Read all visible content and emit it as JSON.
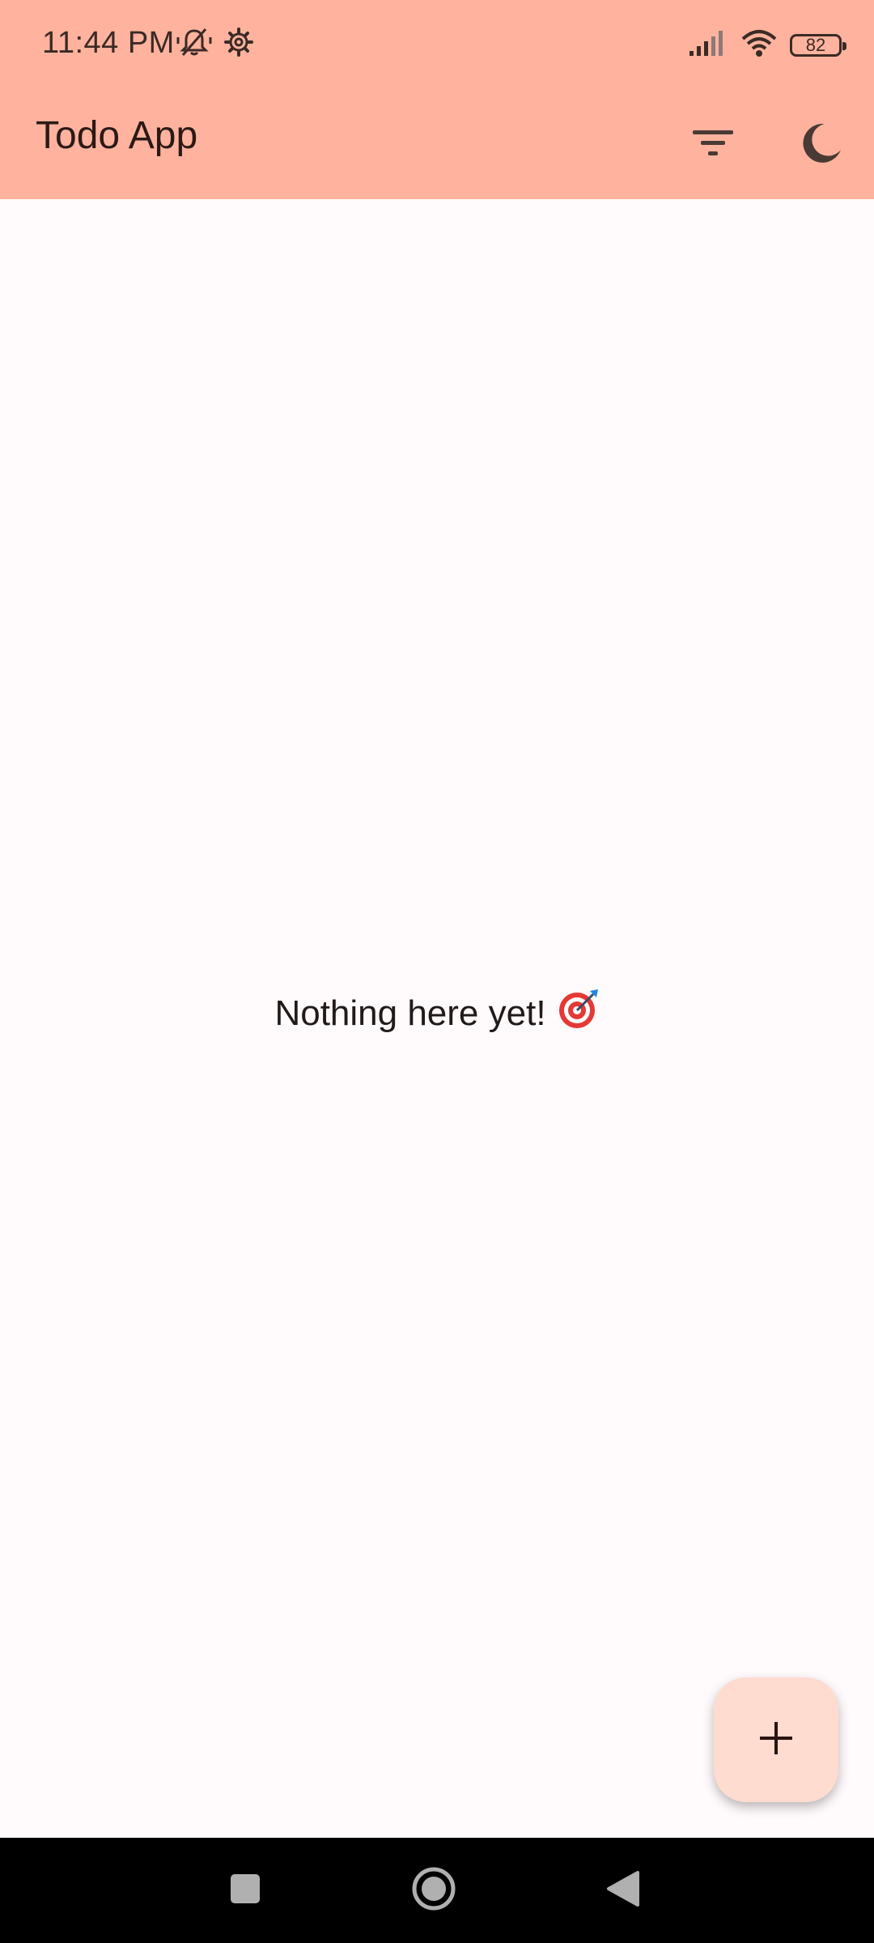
{
  "status_bar": {
    "time": "11:44 PM",
    "battery_level": "82",
    "icons": [
      "mute-icon",
      "settings-gear-icon",
      "signal-icon",
      "wifi-icon",
      "battery-icon"
    ]
  },
  "app_bar": {
    "title": "Todo App",
    "actions": [
      {
        "name": "filter",
        "icon": "filter-list-icon"
      },
      {
        "name": "toggle-theme",
        "icon": "dark-mode-moon-icon"
      }
    ]
  },
  "empty_state": {
    "message": "Nothing here yet!",
    "emoji": "🎯"
  },
  "fab": {
    "icon": "plus-icon",
    "label": "+"
  },
  "navigation_bar": {
    "buttons": [
      "recents",
      "home",
      "back"
    ]
  },
  "colors": {
    "app_bar": "#ffb39e",
    "background": "#fffafc",
    "fab": "#ffdbd0",
    "text": "#2b1a16",
    "nav_bar": "#000000"
  }
}
